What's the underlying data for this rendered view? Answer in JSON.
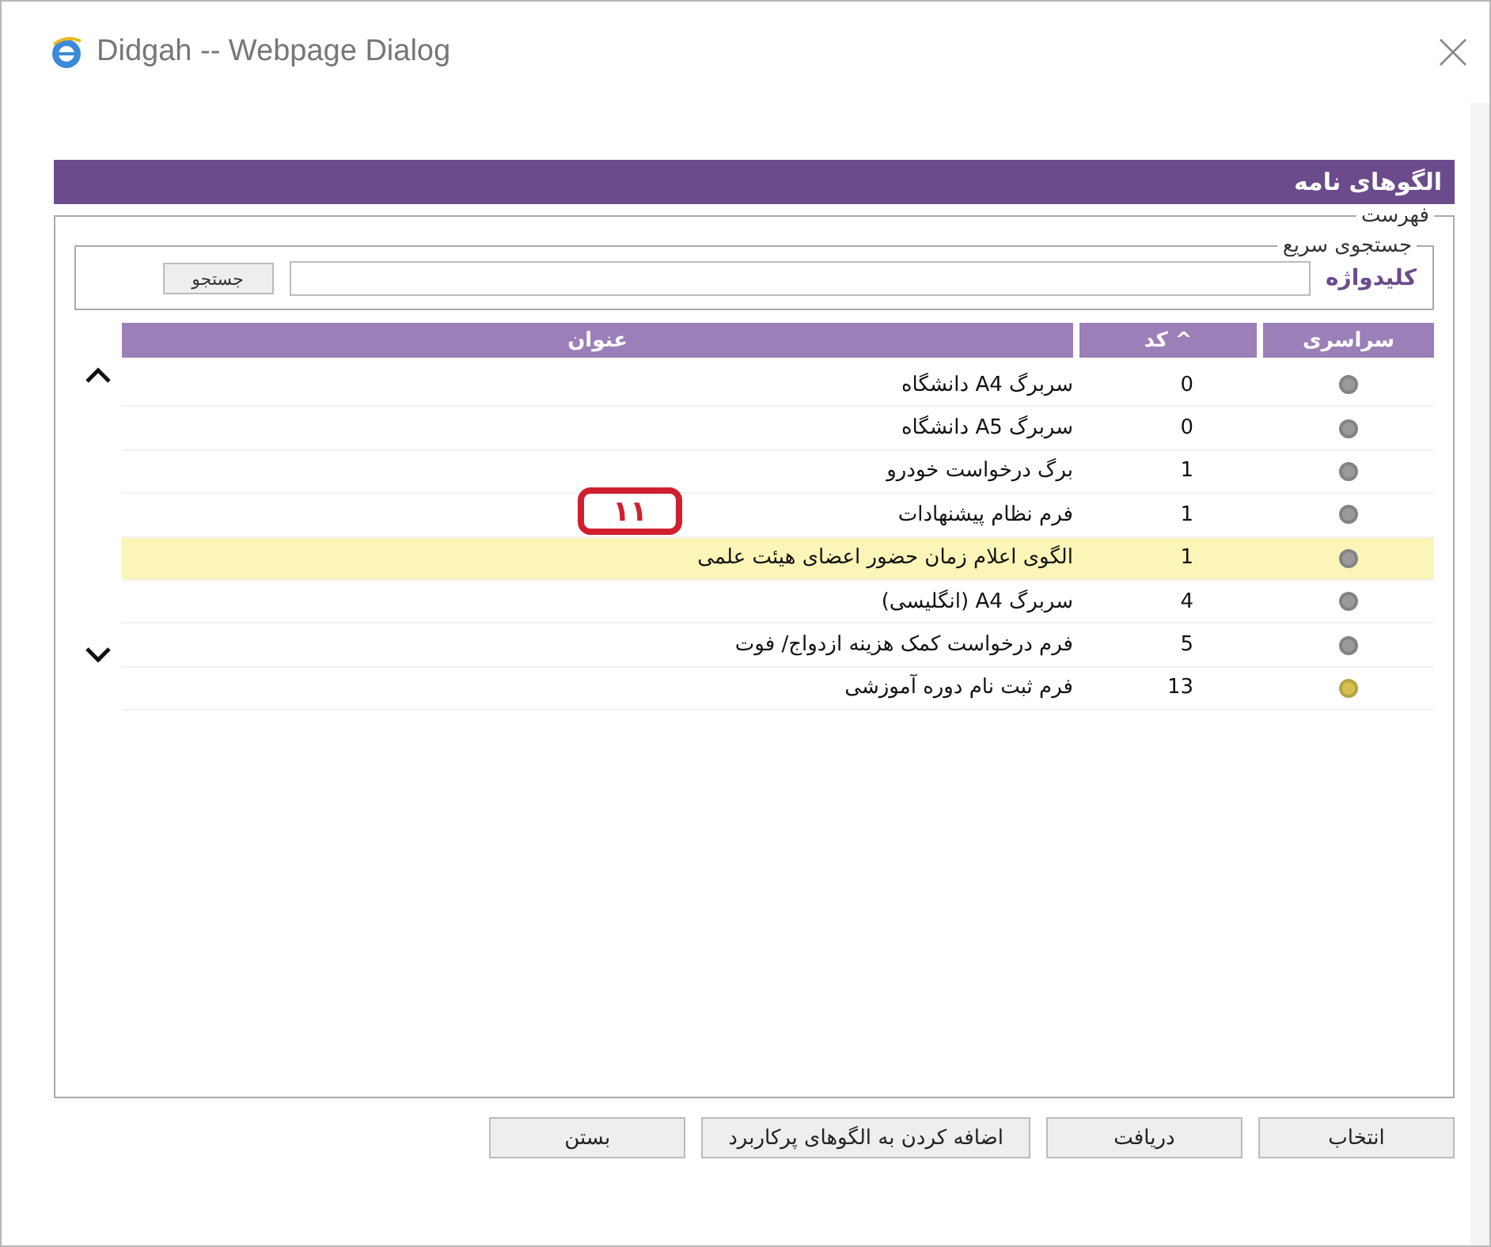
{
  "window": {
    "title": "Didgah -- Webpage Dialog"
  },
  "header": {
    "title": "الگوهای نامه"
  },
  "list_group": {
    "legend": "فهرست"
  },
  "search": {
    "legend": "جستجوی سریع",
    "label": "کلیدواژه",
    "button": "جستجو"
  },
  "table": {
    "columns": [
      {
        "label": "سراسری"
      },
      {
        "label": "^ کد"
      },
      {
        "label": "عنوان"
      }
    ],
    "rows": [
      {
        "color": "#9a9a9a",
        "code": "0",
        "title": "سربرگ A4 دانشگاه",
        "selected": false
      },
      {
        "color": "#9a9a9a",
        "code": "0",
        "title": "سربرگ A5 دانشگاه",
        "selected": false
      },
      {
        "color": "#9a9a9a",
        "code": "1",
        "title": "برگ درخواست خودرو",
        "selected": false
      },
      {
        "color": "#9a9a9a",
        "code": "1",
        "title": "فرم نظام پیشنهادات",
        "selected": false
      },
      {
        "color": "#9a9a9a",
        "code": "1",
        "title": "الگوی اعلام زمان حضور اعضای هیئت علمی",
        "selected": true
      },
      {
        "color": "#9a9a9a",
        "code": "4",
        "title": "سربرگ A4 (انگلیسی)",
        "selected": false
      },
      {
        "color": "#9a9a9a",
        "code": "5",
        "title": "فرم درخواست کمک هزینه ازدواج/ فوت",
        "selected": false
      },
      {
        "color": "#d8c050",
        "code": "13",
        "title": "فرم ثبت نام دوره آموزشی",
        "selected": false
      }
    ]
  },
  "callout": {
    "text": "۱۱"
  },
  "buttons": [
    "انتخاب",
    "دریافت",
    "اضافه کردن به الگوهای پرکاربرد",
    "بستن"
  ]
}
